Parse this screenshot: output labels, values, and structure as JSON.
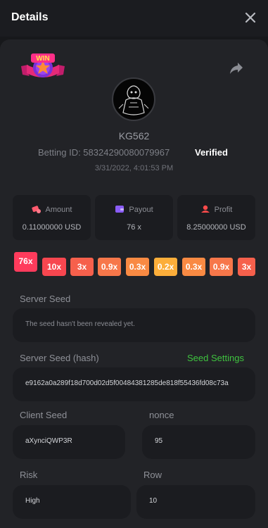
{
  "header": {
    "title": "Details",
    "close_icon": "close-icon"
  },
  "share_icon": "share-arrow-icon",
  "badge": {
    "text": "WIN",
    "icon": "win-badge-icon"
  },
  "avatar_icon": "user-avatar",
  "user": {
    "username": "KG562",
    "betting_id": "Betting ID: 58324290080079967",
    "verified": "Verified",
    "timestamp": "3/31/2022, 4:01:53 PM"
  },
  "stats": {
    "amount": {
      "label": "Amount",
      "value": "0.11000000 USD",
      "icon": "money-icon",
      "color": "#ff5a6e"
    },
    "payout": {
      "label": "Payout",
      "value": "76 x",
      "icon": "wallet-icon",
      "color": "#8a5cf6"
    },
    "profit": {
      "label": "Profit",
      "value": "8.25000000 USD",
      "icon": "profit-icon",
      "color": "#ff4b4b"
    }
  },
  "multipliers": [
    {
      "label": "76x",
      "color": "#ff3b5c",
      "active": true
    },
    {
      "label": "10x",
      "color": "#f7464f"
    },
    {
      "label": "3x",
      "color": "#f6604c"
    },
    {
      "label": "0.9x",
      "color": "#f7774a"
    },
    {
      "label": "0.3x",
      "color": "#f98a43"
    },
    {
      "label": "0.2x",
      "color": "#fcae3a"
    },
    {
      "label": "0.3x",
      "color": "#f98a43"
    },
    {
      "label": "0.9x",
      "color": "#f7774a"
    },
    {
      "label": "3x",
      "color": "#f6604c"
    }
  ],
  "server_seed": {
    "label": "Server Seed",
    "value": "The seed hasn't been revealed yet."
  },
  "server_seed_hash": {
    "label": "Server Seed (hash)",
    "link": "Seed Settings",
    "value": "e9162a0a289f18d700d02d5f00484381285de818f55436fd08c73a"
  },
  "client_seed": {
    "label": "Client Seed",
    "value": "aXynciQWP3R"
  },
  "nonce": {
    "label": "nonce",
    "value": "95"
  },
  "risk": {
    "label": "Risk",
    "value": "High"
  },
  "row": {
    "label": "Row",
    "value": "10"
  }
}
